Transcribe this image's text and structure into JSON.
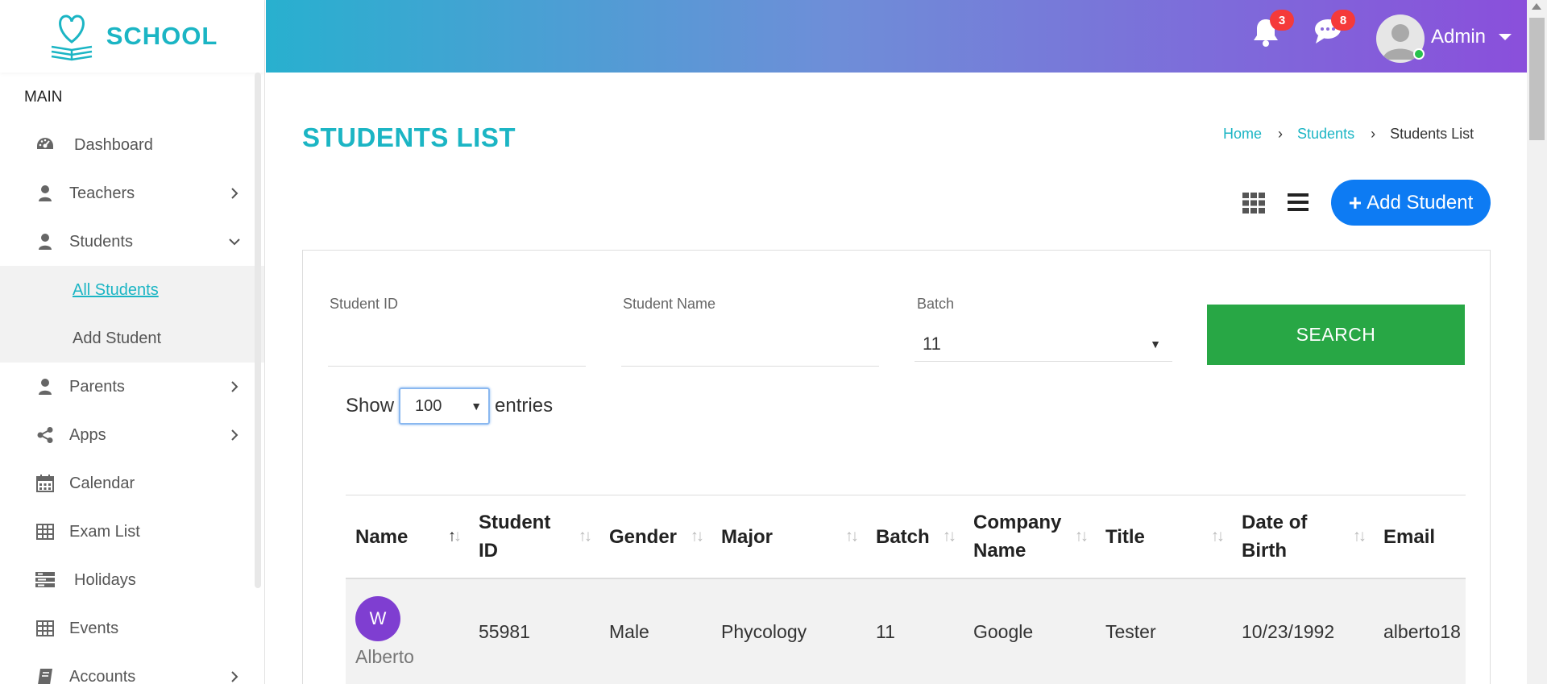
{
  "app": {
    "logo_text": "SCHOOL"
  },
  "sidebar": {
    "section_title": "MAIN",
    "items": [
      {
        "label": "Dashboard",
        "icon": "dashboard-icon"
      },
      {
        "label": "Teachers",
        "icon": "user-icon",
        "has_children": true
      },
      {
        "label": "Students",
        "icon": "user-icon",
        "expanded": true
      },
      {
        "label": "Parents",
        "icon": "user-icon",
        "has_children": true
      },
      {
        "label": "Apps",
        "icon": "share-icon",
        "has_children": true
      },
      {
        "label": "Calendar",
        "icon": "calendar-icon"
      },
      {
        "label": "Exam List",
        "icon": "table-icon"
      },
      {
        "label": "Holidays",
        "icon": "holidays-icon"
      },
      {
        "label": "Events",
        "icon": "table-icon"
      },
      {
        "label": "Accounts",
        "icon": "book-icon",
        "has_children": true
      }
    ],
    "students_sub": [
      {
        "label": "All Students",
        "active": true
      },
      {
        "label": "Add Student"
      }
    ]
  },
  "header": {
    "notifications_count": "3",
    "messages_count": "8",
    "user_name": "Admin"
  },
  "page": {
    "title": "STUDENTS LIST",
    "breadcrumb": [
      "Home",
      "Students",
      "Students List"
    ],
    "add_button": "Add Student"
  },
  "filters": {
    "student_id_label": "Student ID",
    "student_id_value": "",
    "student_name_label": "Student Name",
    "student_name_value": "",
    "batch_label": "Batch",
    "batch_value": "11",
    "search_button": "SEARCH"
  },
  "entries": {
    "show_label": "Show",
    "value": "100",
    "entries_label": "entries"
  },
  "table": {
    "columns": [
      "Name",
      "Student ID",
      "Gender",
      "Major",
      "Batch",
      "Company Name",
      "Title",
      "Date of Birth",
      "Email"
    ],
    "rows": [
      {
        "avatar_letter": "W",
        "name": "Alberto",
        "student_id": "55981",
        "gender": "Male",
        "major": "Phycology",
        "batch": "11",
        "company": "Google",
        "title": "Tester",
        "dob": "10/23/1992",
        "email": "alberto18"
      }
    ]
  },
  "colors": {
    "accent": "#1bb5c4",
    "primary_button": "#0d7bf3",
    "search_button": "#28a745",
    "badge": "#f53a3a",
    "avatar_bg": "#7f3ed1"
  }
}
